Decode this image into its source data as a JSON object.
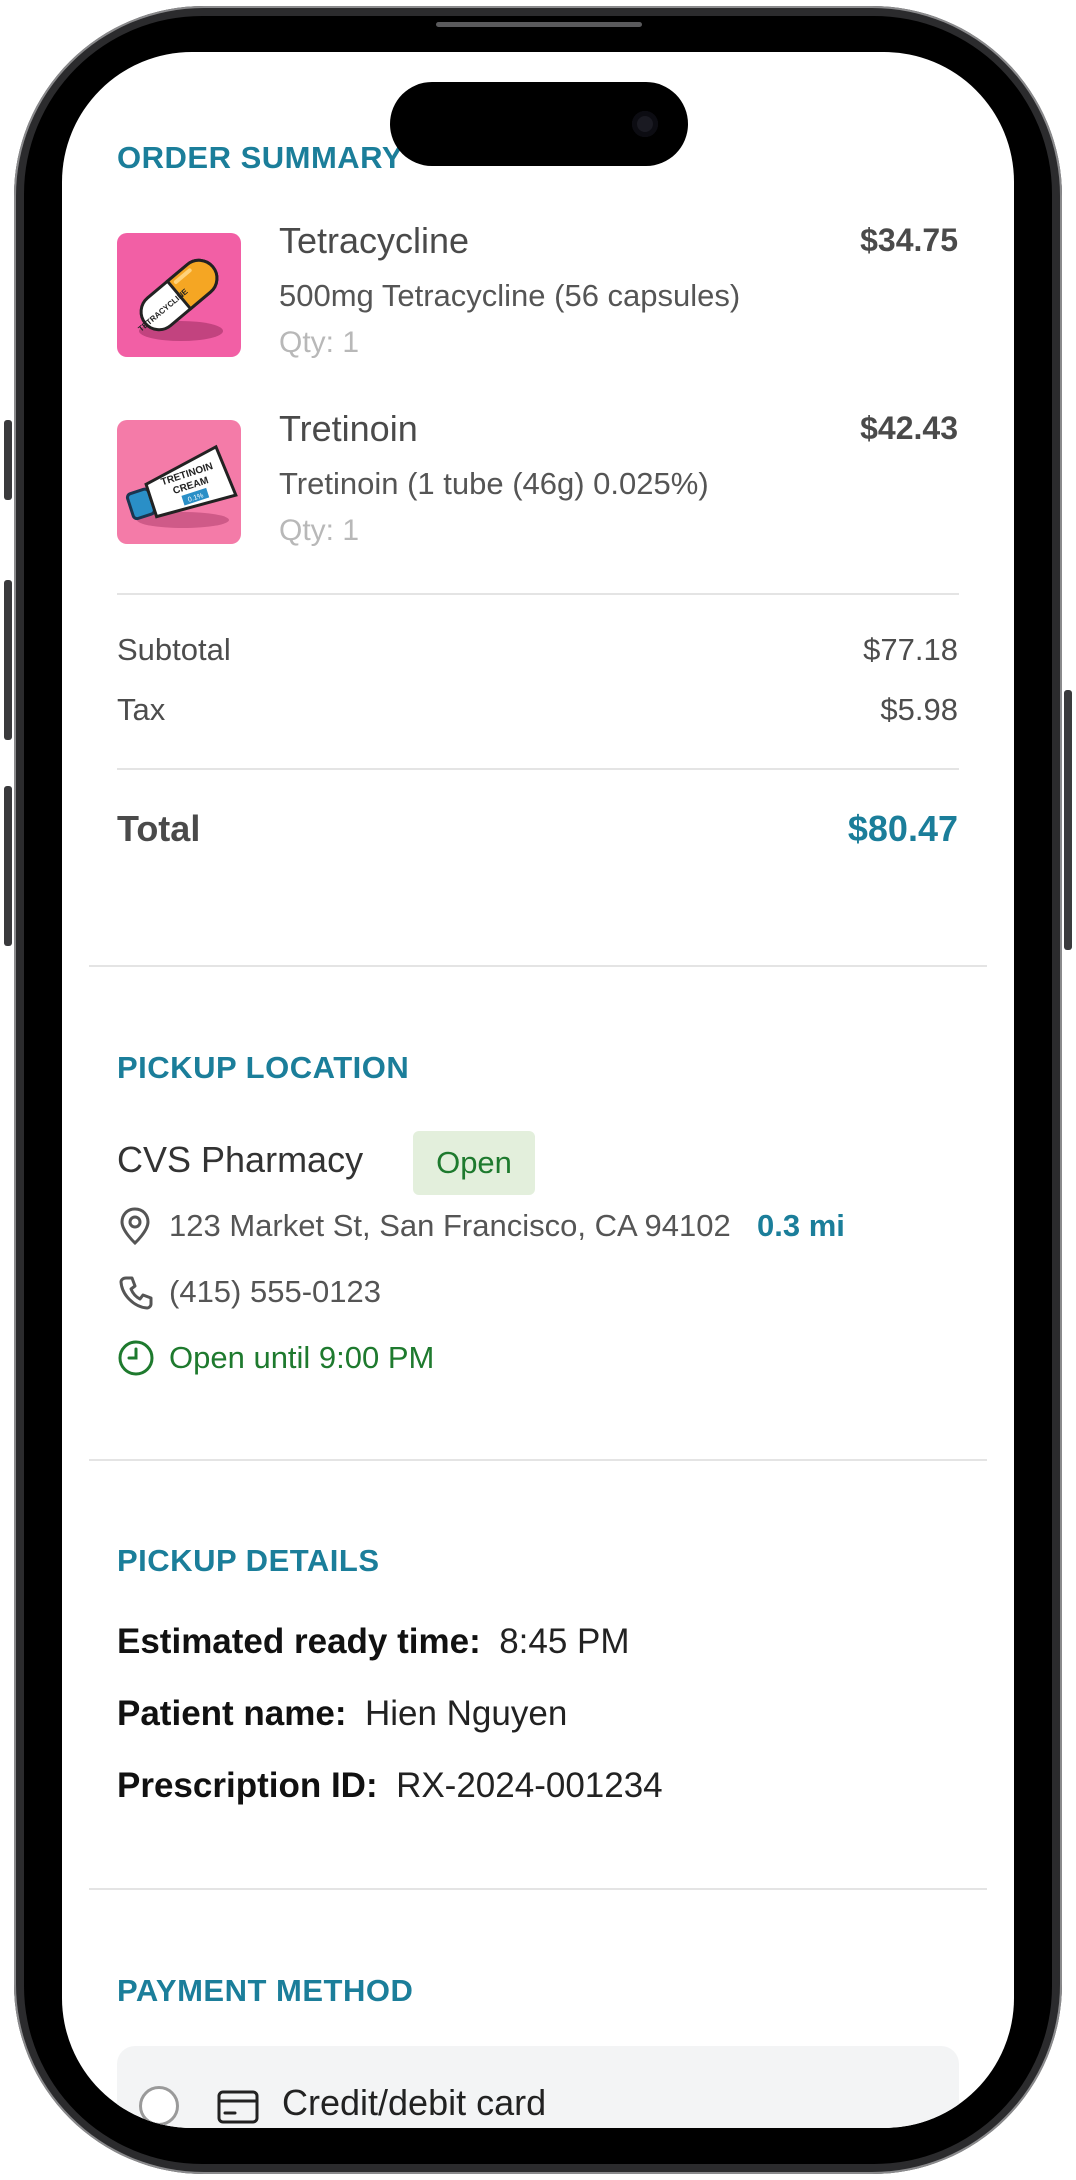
{
  "order_summary": {
    "title": "ORDER SUMMARY",
    "items": [
      {
        "name": "Tetracycline",
        "description": "500mg Tetracycline (56 capsules)",
        "qty": "Qty: 1",
        "price": "$34.75",
        "thumb_label": "TETRACYCLINE",
        "thumb_bg": "#f25fa5"
      },
      {
        "name": "Tretinoin",
        "description": "Tretinoin (1 tube (46g) 0.025%)",
        "qty": "Qty: 1",
        "price": "$42.43",
        "thumb_label_1": "TRETINOIN",
        "thumb_label_2": "CREAM",
        "thumb_label_3": "0.1%",
        "thumb_bg": "#f47ba8"
      }
    ],
    "subtotal_label": "Subtotal",
    "subtotal_value": "$77.18",
    "tax_label": "Tax",
    "tax_value": "$5.98",
    "total_label": "Total",
    "total_value": "$80.47"
  },
  "pickup_location": {
    "title": "PICKUP LOCATION",
    "pharmacy_name": "CVS Pharmacy",
    "status_badge": "Open",
    "address": "123 Market St, San Francisco, CA 94102",
    "distance": "0.3 mi",
    "phone": "(415) 555-0123",
    "hours": "Open until 9:00 PM"
  },
  "pickup_details": {
    "title": "PICKUP DETAILS",
    "ready_label": "Estimated ready time:",
    "ready_value": "8:45 PM",
    "patient_label": "Patient name:",
    "patient_value": "Hien Nguyen",
    "rx_label": "Prescription ID:",
    "rx_value": "RX-2024-001234"
  },
  "payment_method": {
    "title": "PAYMENT METHOD",
    "option_label": "Credit/debit card"
  },
  "colors": {
    "accent": "#1b7e9a",
    "open_green": "#1e7a2e",
    "badge_bg": "#e3efdc"
  }
}
